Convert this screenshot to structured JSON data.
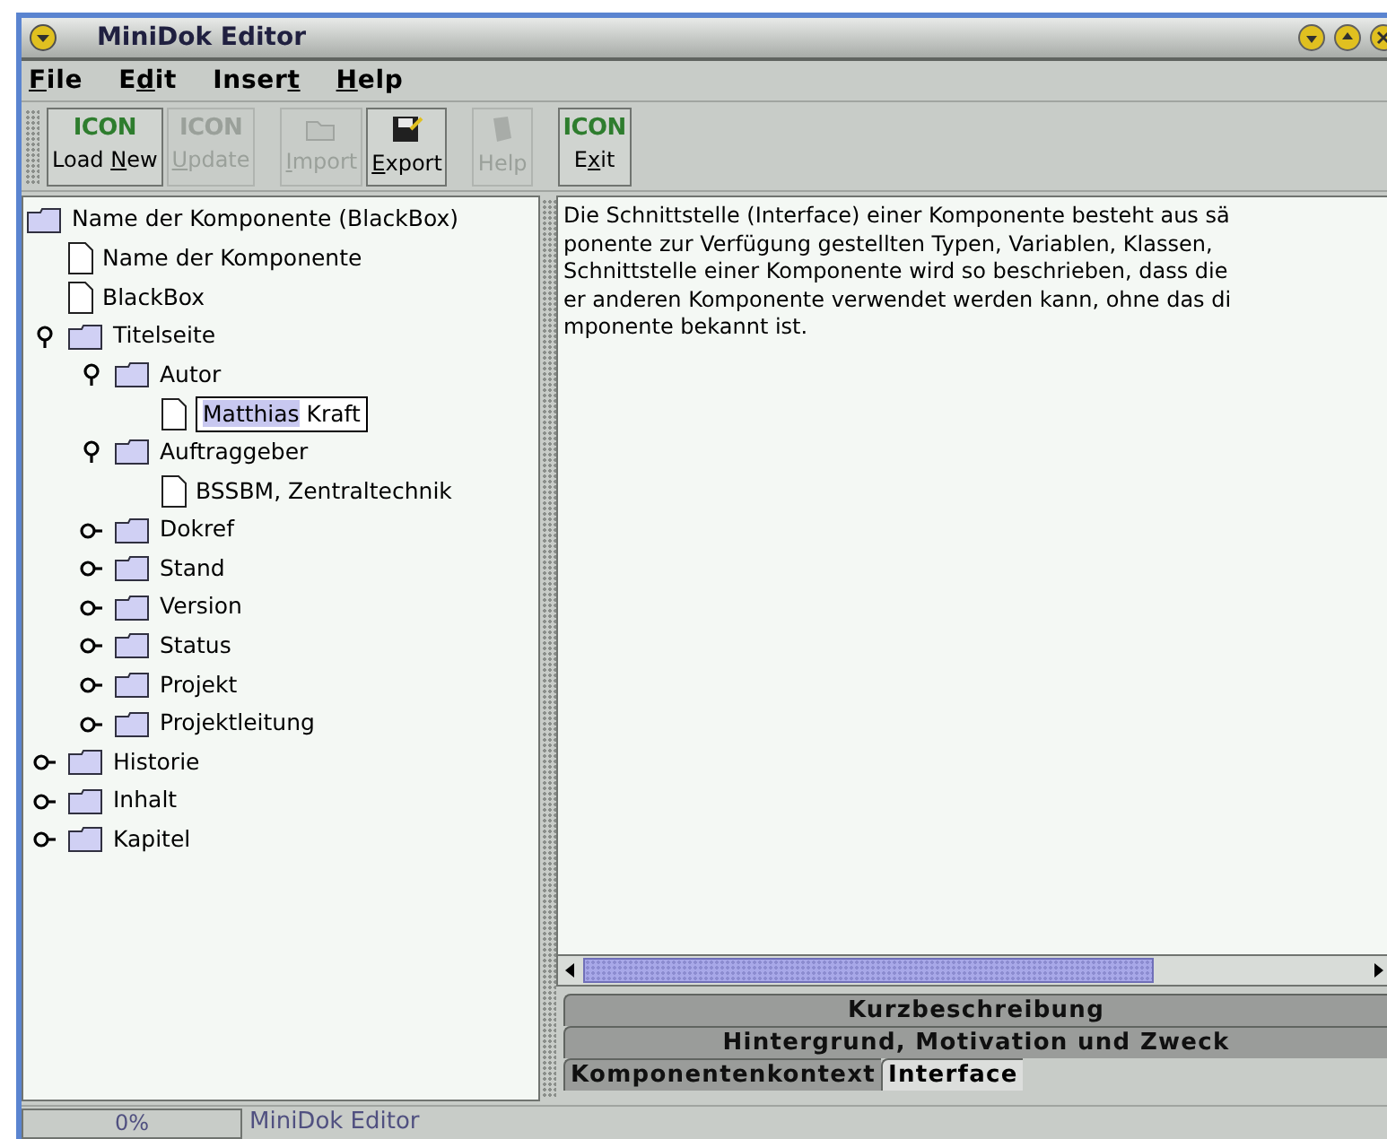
{
  "window": {
    "title": "MiniDok Editor"
  },
  "menu": [
    {
      "key": "F",
      "post": "ile"
    },
    {
      "pre": "E",
      "key": "d",
      "post": "it"
    },
    {
      "pre": "Inser",
      "key": "t"
    },
    {
      "key": "H",
      "post": "elp"
    }
  ],
  "toolbar": [
    [
      {
        "kind": "text_icon",
        "icon_text": "ICON",
        "pre": "Load ",
        "key": "N",
        "post": "ew",
        "disabled": false
      },
      {
        "kind": "text_icon",
        "icon_text": "ICON",
        "key": "U",
        "post": "pdate",
        "disabled": true
      }
    ],
    [
      {
        "kind": "folder",
        "key": "I",
        "post": "mport",
        "disabled": true
      },
      {
        "kind": "floppy",
        "key": "E",
        "post": "xport",
        "disabled": false
      }
    ],
    [
      {
        "kind": "book",
        "post": "Help",
        "disabled": true
      }
    ],
    [
      {
        "kind": "text_icon",
        "icon_text": "ICON",
        "pre": "E",
        "key": "x",
        "post": "it",
        "disabled": false
      }
    ]
  ],
  "tree": {
    "root": {
      "label": "Name der Komponente (BlackBox)",
      "kind": "folder",
      "children": [
        {
          "label": "Name der Komponente",
          "kind": "document"
        },
        {
          "label": "BlackBox",
          "kind": "document"
        },
        {
          "label": "Titelseite",
          "kind": "folder",
          "expanded": true,
          "children": [
            {
              "label": "Autor",
              "kind": "folder",
              "expanded": true,
              "children": [
                {
                  "kind": "document",
                  "editing": true,
                  "value_selected": "Matthias",
                  "value_rest": " Kraft"
                }
              ]
            },
            {
              "label": "Auftraggeber",
              "kind": "folder",
              "expanded": true,
              "children": [
                {
                  "label": "BSSBM, Zentraltechnik",
                  "kind": "document"
                }
              ]
            },
            {
              "label": "Dokref",
              "kind": "folder",
              "expanded": false
            },
            {
              "label": "Stand",
              "kind": "folder",
              "expanded": false
            },
            {
              "label": "Version",
              "kind": "folder",
              "expanded": false
            },
            {
              "label": "Status",
              "kind": "folder",
              "expanded": false
            },
            {
              "label": "Projekt",
              "kind": "folder",
              "expanded": false
            },
            {
              "label": "Projektleitung",
              "kind": "folder",
              "expanded": false
            }
          ]
        },
        {
          "label": "Historie",
          "kind": "folder",
          "expanded": false
        },
        {
          "label": "Inhalt",
          "kind": "folder",
          "expanded": false
        },
        {
          "label": "Kapitel",
          "kind": "folder",
          "expanded": false
        }
      ]
    }
  },
  "editor": {
    "lines": [
      "Die Schnittstelle (Interface) einer Komponente besteht aus sä",
      "ponente zur Verfügung gestellten Typen, Variablen, Klassen,",
      "Schnittstelle einer Komponente wird so beschrieben, dass die",
      "er anderen Komponente verwendet werden kann, ohne das di",
      "mponente bekannt ist."
    ]
  },
  "tab_rows": [
    [
      {
        "label": "Kurzbeschreibung",
        "selected": false
      }
    ],
    [
      {
        "label": "Hintergrund, Motivation und Zweck",
        "selected": false
      }
    ],
    [
      {
        "label": "Komponentenkontext",
        "selected": false
      },
      {
        "label": "Interface",
        "selected": true
      }
    ]
  ],
  "status_bar": {
    "progress": {
      "text": "0%",
      "level": 0
    },
    "message": "MiniDok Editor"
  }
}
